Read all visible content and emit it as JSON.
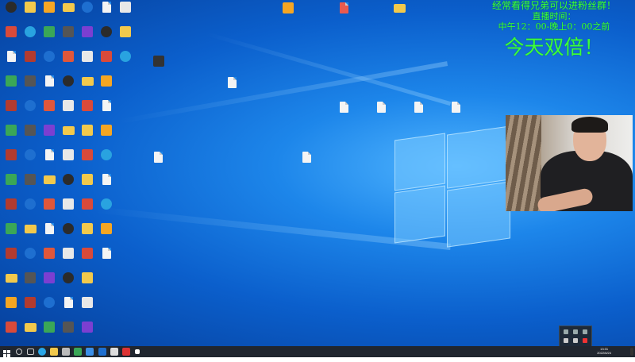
{
  "stream_overlay": {
    "line1": "经常看得兄弟可以进粉丝群！",
    "line2": "直播时间：",
    "line3": "中午12：00-晚上0：00之前",
    "headline": "今天双倍！"
  },
  "desktop": {
    "icon_kinds": [
      "app",
      "app",
      "app",
      "app",
      "app",
      "folder",
      "doc",
      "app",
      "app",
      "app",
      "app",
      "app",
      "app",
      "app",
      "doc",
      "app",
      "app",
      "app",
      "app",
      "doc",
      "doc",
      "doc",
      "doc",
      "doc",
      "app",
      "app",
      "app",
      "app",
      "app"
    ]
  },
  "taskbar": {
    "clock_time": "13:31",
    "clock_date": "2022/6/24"
  }
}
